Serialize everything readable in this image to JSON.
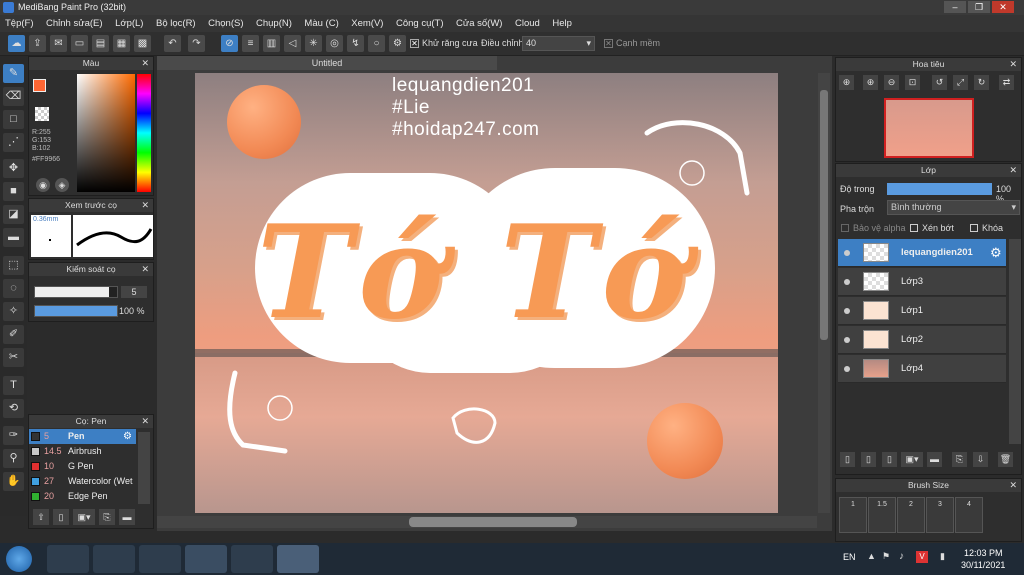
{
  "window": {
    "title": "MediBang Paint Pro (32bit)",
    "buttons": [
      "–",
      "❐",
      "✕"
    ]
  },
  "menu": [
    "Tệp(F)",
    "Chỉnh sửa(E)",
    "Lớp(L)",
    "Bộ lọc(R)",
    "Chọn(S)",
    "Chụp(N)",
    "Màu (C)",
    "Xem(V)",
    "Công cụ(T)",
    "Cửa số(W)",
    "Cloud",
    "Help"
  ],
  "toolbar": {
    "antialias_label": "Khử răng cưa",
    "adjust_label": "Điều chỉnh",
    "adjust_value": "40",
    "edge_label": "Cạnh mềm"
  },
  "color_panel": {
    "title": "Màu",
    "r": "R:255",
    "g": "G:153",
    "b": "B:102",
    "hex": "#FF9966",
    "primary": "#ff6633",
    "secondary": "#ffffff"
  },
  "brush_preview": {
    "title": "Xem trước cọ",
    "size": "0.36mm"
  },
  "brush_control": {
    "title": "Kiểm soát cọ",
    "size_value": "5",
    "opacity_value": "100 %",
    "size_fraction": 0.9,
    "opacity_fraction": 1.0
  },
  "brush_list": {
    "title": "Cọ: Pen",
    "items": [
      {
        "size": "5",
        "name": "Pen",
        "color": "#333333"
      },
      {
        "size": "14.5",
        "name": "Airbrush",
        "color": "#c8c8c8"
      },
      {
        "size": "10",
        "name": "G Pen",
        "color": "#e03030"
      },
      {
        "size": "27",
        "name": "Watercolor (Wet",
        "color": "#40a0e0"
      },
      {
        "size": "20",
        "name": "Edge Pen",
        "color": "#30b030"
      }
    ]
  },
  "canvas": {
    "tab": "Untitled",
    "watermark": [
      "lequangdien201",
      "#Lie",
      "#hoidap247.com"
    ],
    "artwork_text": "Tớ Tớ"
  },
  "navigator": {
    "title": "Hoa tiêu"
  },
  "layers_panel": {
    "title": "Lớp",
    "opacity_label": "Độ trong",
    "opacity_value": "100 %",
    "opacity_fraction": 1.0,
    "blend_label": "Pha trộn",
    "blend_value": "Bình thường",
    "protect_alpha": "Bảo vệ alpha",
    "clipping": "Xén bớt",
    "lock": "Khóa",
    "layers": [
      "lequangdien201",
      "Lớp3",
      "Lớp1",
      "Lớp2",
      "Lớp4"
    ]
  },
  "brush_size_panel": {
    "title": "Brush Size",
    "sizes": [
      "1",
      "1.5",
      "2",
      "3",
      "4"
    ]
  },
  "taskbar": {
    "lang": "EN",
    "time": "12:03 PM",
    "date": "30/11/2021"
  }
}
